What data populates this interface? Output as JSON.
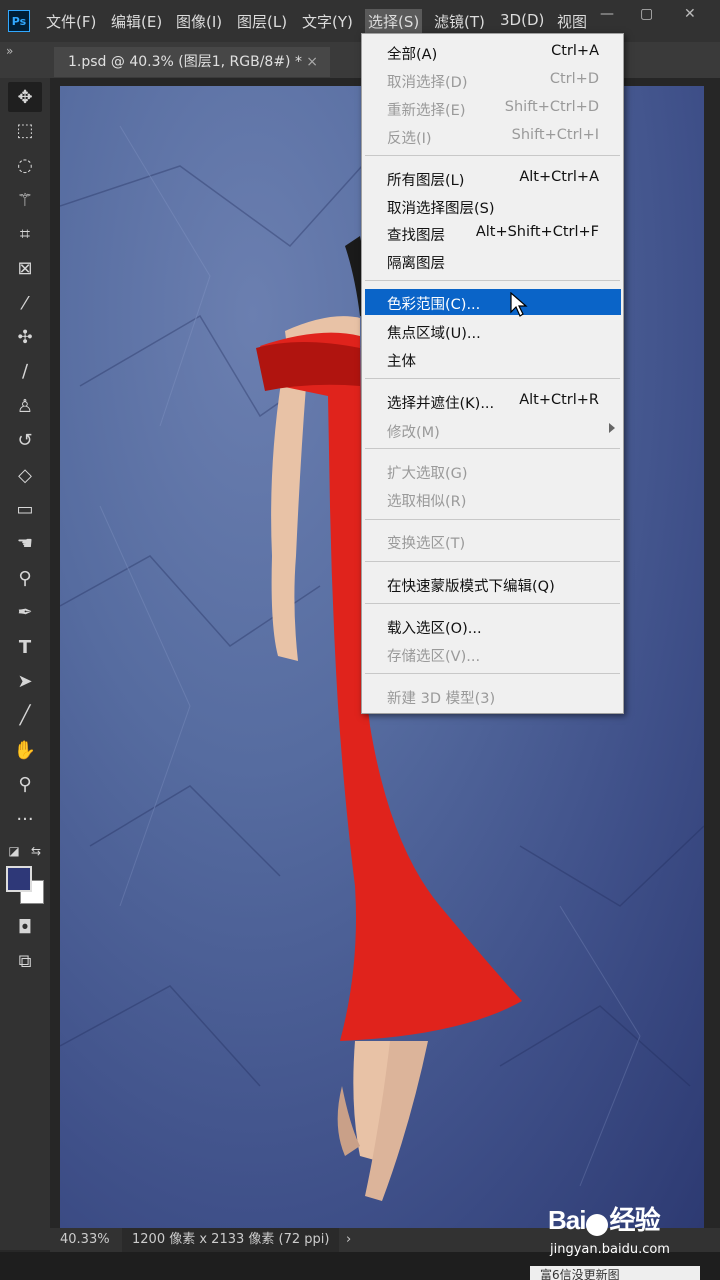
{
  "app": {
    "logo_text": "Ps"
  },
  "menubar": {
    "items": [
      "文件(F)",
      "编辑(E)",
      "图像(I)",
      "图层(L)",
      "文字(Y)",
      "选择(S)",
      "滤镜(T)",
      "3D(D)",
      "视图"
    ],
    "window_controls": [
      "—",
      "▢",
      "✕"
    ]
  },
  "document": {
    "tab_title": "1.psd @ 40.3% (图层1, RGB/8#) *",
    "tab_close": "×",
    "collapse_glyph": "»"
  },
  "toolbar": {
    "tools": [
      "move-tool",
      "marquee-tool",
      "lasso-tool",
      "magic-wand-tool",
      "crop-tool",
      "frame-tool",
      "eyedropper-tool",
      "healing-brush-tool",
      "brush-tool",
      "clone-stamp-tool",
      "history-brush-tool",
      "eraser-tool",
      "gradient-tool",
      "smudge-tool",
      "dodge-tool",
      "pen-tool",
      "type-tool",
      "path-selection-tool",
      "line-tool",
      "hand-tool",
      "zoom-tool",
      "more-tools"
    ],
    "colors": {
      "foreground": "#2e3878",
      "background": "#ffffff"
    }
  },
  "select_menu": {
    "items": [
      {
        "label": "全部(A)",
        "shortcut": "Ctrl+A",
        "enabled": true
      },
      {
        "label": "取消选择(D)",
        "shortcut": "Ctrl+D",
        "enabled": false
      },
      {
        "label": "重新选择(E)",
        "shortcut": "Shift+Ctrl+D",
        "enabled": false
      },
      {
        "label": "反选(I)",
        "shortcut": "Shift+Ctrl+I",
        "enabled": false
      },
      {
        "label": "所有图层(L)",
        "shortcut": "Alt+Ctrl+A",
        "enabled": true
      },
      {
        "label": "取消选择图层(S)",
        "shortcut": "",
        "enabled": true
      },
      {
        "label": "查找图层",
        "shortcut": "Alt+Shift+Ctrl+F",
        "enabled": true
      },
      {
        "label": "隔离图层",
        "shortcut": "",
        "enabled": true
      },
      {
        "label": "色彩范围(C)...",
        "shortcut": "",
        "enabled": true,
        "highlighted": true
      },
      {
        "label": "焦点区域(U)...",
        "shortcut": "",
        "enabled": true
      },
      {
        "label": "主体",
        "shortcut": "",
        "enabled": true
      },
      {
        "label": "选择并遮住(K)...",
        "shortcut": "Alt+Ctrl+R",
        "enabled": true
      },
      {
        "label": "修改(M)",
        "shortcut": "",
        "enabled": false,
        "submenu": true
      },
      {
        "label": "扩大选取(G)",
        "shortcut": "",
        "enabled": false
      },
      {
        "label": "选取相似(R)",
        "shortcut": "",
        "enabled": false
      },
      {
        "label": "变换选区(T)",
        "shortcut": "",
        "enabled": false
      },
      {
        "label": "在快速蒙版模式下编辑(Q)",
        "shortcut": "",
        "enabled": true
      },
      {
        "label": "载入选区(O)...",
        "shortcut": "",
        "enabled": true
      },
      {
        "label": "存储选区(V)...",
        "shortcut": "",
        "enabled": false
      },
      {
        "label": "新建 3D 模型(3)",
        "shortcut": "",
        "enabled": false
      }
    ]
  },
  "status": {
    "zoom": "40.33%",
    "dimensions": "1200 像素 x 2133 像素 (72 ppi)",
    "arrow": "›"
  },
  "watermark": {
    "brand_left": "Bai",
    "brand_right": "经验",
    "url": "jingyan.baidu.com"
  },
  "bottom_tab": {
    "text": "富6信没更新图"
  },
  "canvas": {
    "colors": {
      "background_paper": "#4a5c94",
      "dress": "#e0231c"
    }
  }
}
